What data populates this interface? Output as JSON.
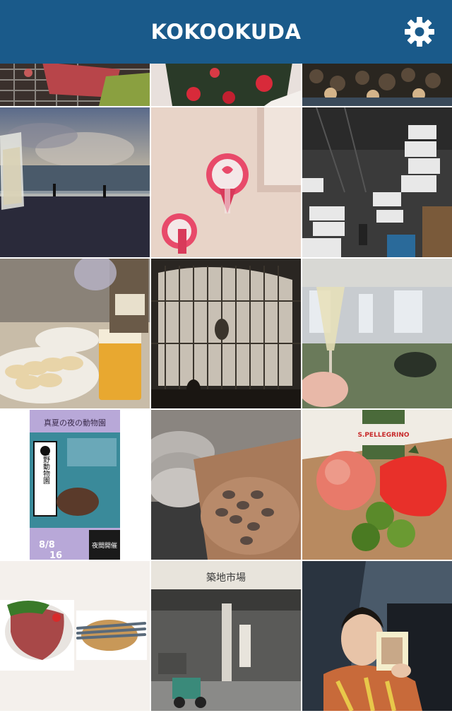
{
  "header": {
    "title": "KOKOOKUDA",
    "settings_icon": "gear-icon"
  },
  "colors": {
    "header_bg": "#1a5a8a",
    "header_text": "#ffffff",
    "grid_gap": "#ffffff"
  },
  "photo_texts": {
    "zoo_poster_title": "真夏の夜の動物園",
    "zoo_poster_name": "上野動物園",
    "zoo_poster_dates": "8/8",
    "zoo_poster_end": "16",
    "zoo_poster_badge": "夜間開催",
    "water_brand": "S.PELLEGRINO",
    "market_sign": "築地市場"
  }
}
